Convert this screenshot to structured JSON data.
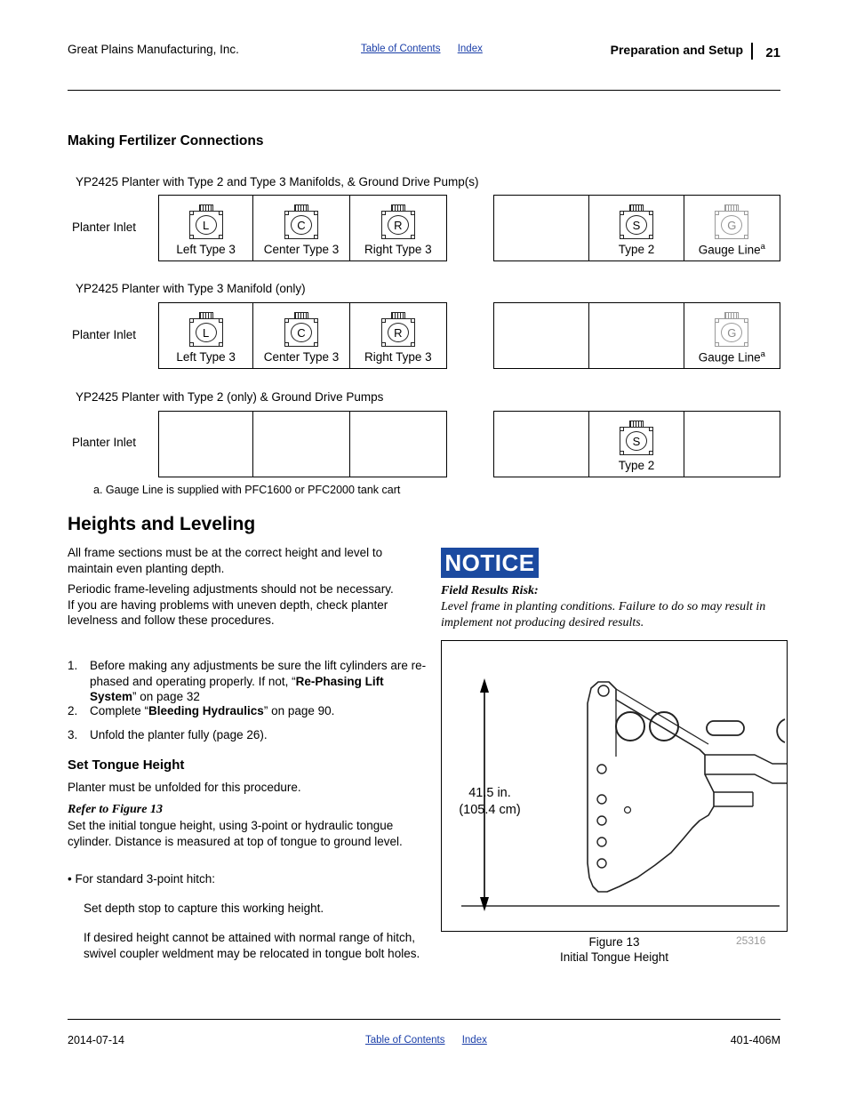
{
  "header": {
    "company": "Great Plains Manufacturing, Inc.",
    "toc_link": "Table of Contents",
    "index_link": "Index",
    "section": "Preparation and Setup",
    "page_number": "21"
  },
  "fertilizer": {
    "heading": "Making Fertilizer Connections",
    "row_label": "Planter Inlet",
    "groups": [
      {
        "caption": "YP2425 Planter with Type 2 and Type 3 Manifolds, & Ground Drive Pump(s)",
        "left_cells": [
          {
            "icon": "manifold-icon",
            "letter": "L",
            "label": "Left Type 3"
          },
          {
            "icon": "manifold-icon",
            "letter": "C",
            "label": "Center Type 3"
          },
          {
            "icon": "manifold-icon",
            "letter": "R",
            "label": "Right Type 3"
          }
        ],
        "right_cells": [
          {
            "icon": "",
            "letter": "",
            "label": ""
          },
          {
            "icon": "manifold-icon",
            "letter": "S",
            "label": "Type 2"
          },
          {
            "icon": "gauge-icon",
            "letter": "G",
            "label": "Gauge Line",
            "sup": "a"
          }
        ]
      },
      {
        "caption": "YP2425 Planter with Type 3 Manifold (only)",
        "left_cells": [
          {
            "icon": "manifold-icon",
            "letter": "L",
            "label": "Left Type 3"
          },
          {
            "icon": "manifold-icon",
            "letter": "C",
            "label": "Center Type 3"
          },
          {
            "icon": "manifold-icon",
            "letter": "R",
            "label": "Right Type 3"
          }
        ],
        "right_cells": [
          {
            "icon": "",
            "letter": "",
            "label": ""
          },
          {
            "icon": "",
            "letter": "",
            "label": ""
          },
          {
            "icon": "gauge-icon",
            "letter": "G",
            "label": "Gauge Line",
            "sup": "a"
          }
        ]
      },
      {
        "caption": "YP2425 Planter with Type 2 (only) & Ground Drive Pumps",
        "left_cells": [
          {
            "icon": "",
            "letter": "",
            "label": ""
          },
          {
            "icon": "",
            "letter": "",
            "label": ""
          },
          {
            "icon": "",
            "letter": "",
            "label": ""
          }
        ],
        "right_cells": [
          {
            "icon": "",
            "letter": "",
            "label": ""
          },
          {
            "icon": "manifold-icon",
            "letter": "S",
            "label": "Type 2"
          },
          {
            "icon": "",
            "letter": "",
            "label": ""
          }
        ]
      }
    ],
    "footnote": "a.  Gauge Line is supplied with PFC1600 or PFC2000 tank cart"
  },
  "heights": {
    "heading": "Heights and Leveling",
    "para1": "All frame sections must be at the correct height and level to maintain even planting depth.",
    "para2": "Periodic frame-leveling adjustments should not be necessary. If you are having problems with uneven depth, check planter levelness and follow these procedures.",
    "steps": [
      {
        "num": "1.",
        "text_a": "Before making any adjustments be sure the lift cylinders are re-phased and operating properly. If not, “",
        "bold": "Re-Phasing Lift System",
        "text_b": "” on page 32"
      },
      {
        "num": "2.",
        "text_a": "Complete “",
        "bold": "Bleeding Hydraulics",
        "text_b": "” on page 90."
      },
      {
        "num": "3.",
        "text_a": "Unfold the planter fully (page 26).",
        "bold": "",
        "text_b": ""
      }
    ]
  },
  "tongue": {
    "heading": "Set Tongue Height",
    "para1": "Planter must be unfolded for this procedure.",
    "refer": "Refer to Figure 13",
    "para2": "Set the initial tongue height, using 3-point or hydraulic tongue cylinder. Distance is measured at top of tongue to ground level.",
    "bullet1": "•  For standard 3-point hitch:",
    "para3": "Set depth stop to capture this working height.",
    "para4": "If desired height cannot be attained with normal range of hitch, swivel coupler weldment may be relocated in tongue bolt holes."
  },
  "notice": {
    "label": "NOTICE",
    "title": "Field Results Risk:",
    "body": "Level frame in planting conditions. Failure to do so may result in implement not producing desired results."
  },
  "figure": {
    "dim_in": "41.5 in.",
    "dim_cm": "(105.4 cm)",
    "caption_line1": "Figure 13",
    "caption_line2": "Initial Tongue Height",
    "art_number": "25316"
  },
  "footer": {
    "date": "2014-07-14",
    "toc_link": "Table of Contents",
    "index_link": "Index",
    "doc_number": "401-406M"
  }
}
